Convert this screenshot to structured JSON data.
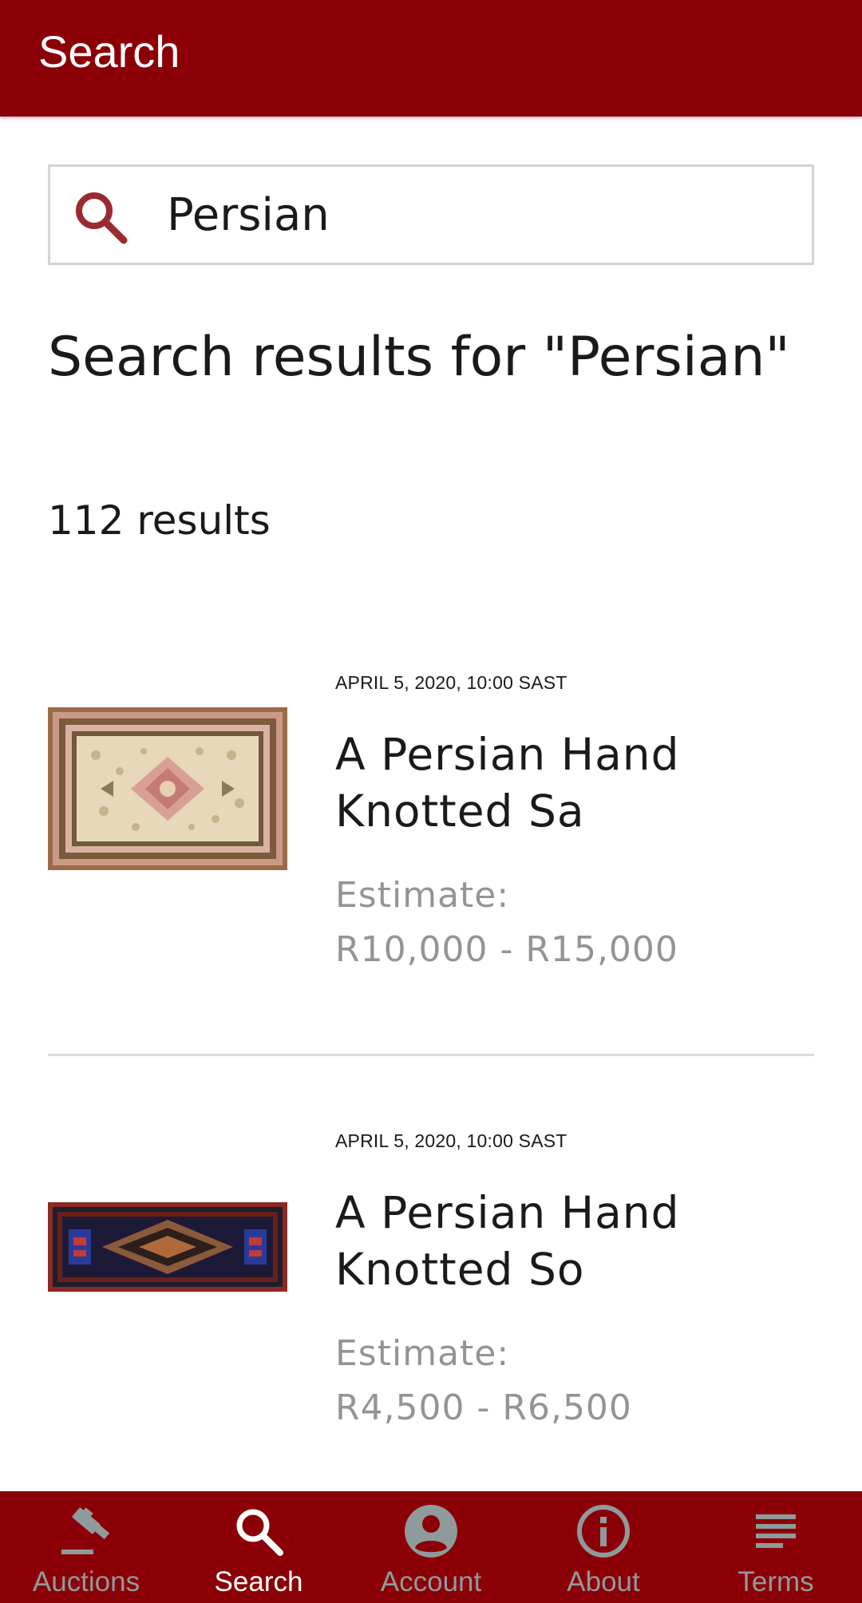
{
  "app_bar": {
    "title": "Search"
  },
  "search": {
    "value": "Persian",
    "icon": "search-icon",
    "accent_color": "#9b2a2f"
  },
  "results": {
    "heading": "Search results for \"Persian\"",
    "count_text": "112 results",
    "items": [
      {
        "date": "APRIL 5, 2020, 10:00 SAST",
        "title": "A Persian Hand Knotted Sa",
        "estimate_label": "Estimate:",
        "estimate_value": "R10,000 - R15,000"
      },
      {
        "date": "APRIL 5, 2020, 10:00 SAST",
        "title": "A Persian Hand Knotted So",
        "estimate_label": "Estimate:",
        "estimate_value": "R4,500 - R6,500"
      }
    ]
  },
  "bottom_nav": {
    "active": "Search",
    "items": [
      {
        "label": "Auctions",
        "icon": "gavel-icon"
      },
      {
        "label": "Search",
        "icon": "search-icon"
      },
      {
        "label": "Account",
        "icon": "account-circle-icon"
      },
      {
        "label": "About",
        "icon": "info-icon"
      },
      {
        "label": "Terms",
        "icon": "list-lines-icon"
      }
    ]
  },
  "colors": {
    "brand": "#8b0007",
    "nav_inactive": "#8f9a9b",
    "estimate_text": "#949494"
  }
}
